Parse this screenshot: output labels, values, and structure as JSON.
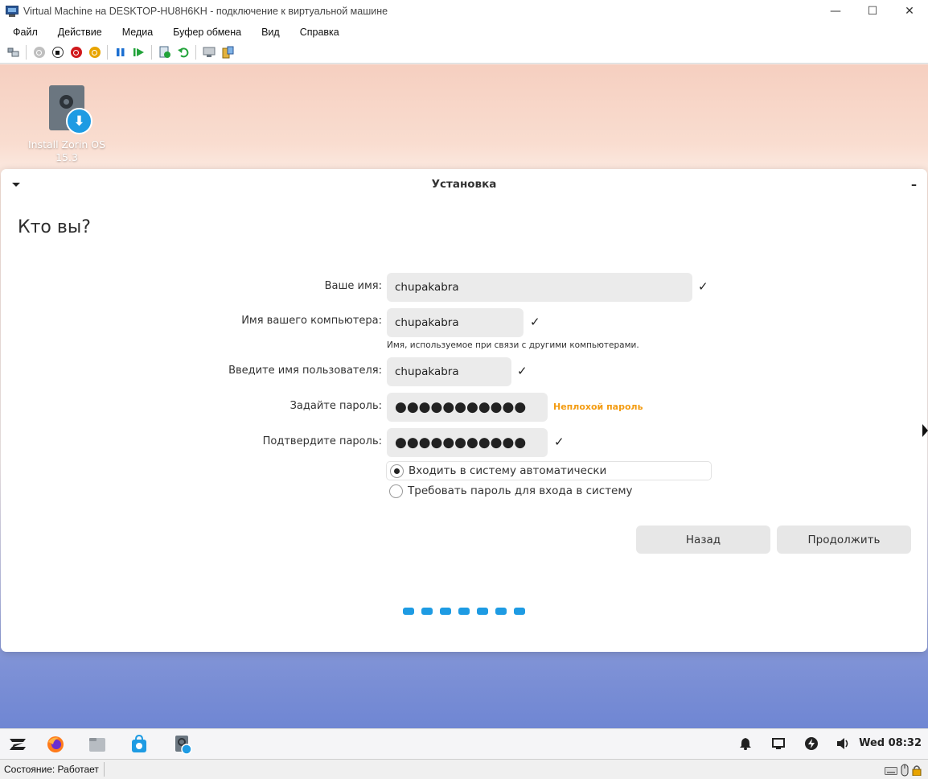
{
  "window": {
    "title": "Virtual Machine на DESKTOP-HU8H6KH - подключение к виртуальной машине",
    "controls": {
      "minimize": "—",
      "maximize": "☐",
      "close": "✕"
    }
  },
  "menubar": {
    "items": [
      "Файл",
      "Действие",
      "Медиа",
      "Буфер обмена",
      "Вид",
      "Справка"
    ]
  },
  "toolbar": {
    "icons": [
      "ctrl-alt-del-icon",
      "start-icon",
      "turn-off-icon",
      "shutdown-icon",
      "save-state-icon",
      "pause-icon",
      "resume-icon",
      "checkpoint-icon",
      "revert-icon",
      "enhanced-session-icon",
      "share-icon"
    ]
  },
  "desktop": {
    "icon_label_line1": "Install Zorin OS",
    "icon_label_line2": "15.3"
  },
  "installer": {
    "title": "Установка",
    "heading": "Кто вы?",
    "fields": {
      "name_label": "Ваше имя:",
      "name_value": "chupakabra",
      "computer_label": "Имя вашего компьютера:",
      "computer_value": "chupakabra",
      "computer_hint": "Имя, используемое при связи с другими компьютерами.",
      "username_label": "Введите имя пользователя:",
      "username_value": "chupakabra",
      "password_label": "Задайте пароль:",
      "password_value": "●●●●●●●●●●●",
      "password_strength": "Неплохой пароль",
      "confirm_label": "Подтвердите пароль:",
      "confirm_value": "●●●●●●●●●●●"
    },
    "login_options": {
      "auto": "Входить в систему автоматически",
      "require_password": "Требовать пароль для входа в систему",
      "selected": "auto"
    },
    "buttons": {
      "back": "Назад",
      "continue": "Продолжить"
    },
    "progress_steps": 7,
    "check_mark": "✓"
  },
  "taskbar": {
    "clock": "Wed 08:32"
  },
  "statusbar": {
    "status": "Состояние: Работает"
  },
  "colors": {
    "accent": "#1e9be3",
    "password_strength": "#f39c12"
  }
}
